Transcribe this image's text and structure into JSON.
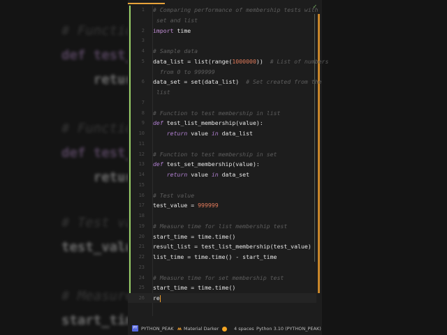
{
  "background_blur": [
    {
      "text": "# Functio",
      "cls": "c"
    },
    {
      "text": "def test_l",
      "cls": "k"
    },
    {
      "text": "    return",
      "cls": ""
    },
    {
      "text": "# Functio",
      "cls": "c"
    },
    {
      "text": "def test_s",
      "cls": "k"
    },
    {
      "text": "    return",
      "cls": ""
    },
    {
      "text": "# Test va",
      "cls": "c"
    },
    {
      "text": "test_value",
      "cls": ""
    },
    {
      "text": "# Measure",
      "cls": "c"
    },
    {
      "text": "start_time",
      "cls": ""
    }
  ],
  "editor": {
    "rows": [
      {
        "ln": "1",
        "html": [
          [
            "cm",
            "# Comparing performance of membership tests with"
          ]
        ]
      },
      {
        "ln": "",
        "html": [
          [
            "cm",
            " set and list"
          ]
        ]
      },
      {
        "ln": "2",
        "html": [
          [
            "kw",
            "import"
          ],
          [
            "",
            " time"
          ]
        ]
      },
      {
        "ln": "3",
        "html": []
      },
      {
        "ln": "4",
        "html": [
          [
            "cm",
            "# Sample data"
          ]
        ]
      },
      {
        "ln": "5",
        "html": [
          [
            "",
            "data_list = list(range("
          ],
          [
            "num",
            "1000000"
          ],
          [
            "",
            "))  "
          ],
          [
            "cm",
            "# List of numbers"
          ]
        ]
      },
      {
        "ln": "",
        "html": [
          [
            "cm",
            "  from 0 to 999999"
          ]
        ]
      },
      {
        "ln": "6",
        "html": [
          [
            "",
            "data_set = set(data_list)  "
          ],
          [
            "cm",
            "# Set created from the"
          ]
        ]
      },
      {
        "ln": "",
        "html": [
          [
            "cm",
            " list"
          ]
        ]
      },
      {
        "ln": "7",
        "html": []
      },
      {
        "ln": "8",
        "html": [
          [
            "cm",
            "# Function to test membership in list"
          ]
        ]
      },
      {
        "ln": "9",
        "html": [
          [
            "kwi",
            "def"
          ],
          [
            "",
            " test_list_membership(value):"
          ]
        ]
      },
      {
        "ln": "10",
        "html": [
          [
            "",
            "    "
          ],
          [
            "kwi",
            "return"
          ],
          [
            "",
            " value "
          ],
          [
            "kwi",
            "in"
          ],
          [
            "",
            " data_list"
          ]
        ]
      },
      {
        "ln": "11",
        "html": []
      },
      {
        "ln": "12",
        "html": [
          [
            "cm",
            "# Function to test membership in set"
          ]
        ]
      },
      {
        "ln": "13",
        "html": [
          [
            "kwi",
            "def"
          ],
          [
            "",
            " test_set_membership(value):"
          ]
        ]
      },
      {
        "ln": "14",
        "html": [
          [
            "",
            "    "
          ],
          [
            "kwi",
            "return"
          ],
          [
            "",
            " value "
          ],
          [
            "kwi",
            "in"
          ],
          [
            "",
            " data_set"
          ]
        ]
      },
      {
        "ln": "15",
        "html": []
      },
      {
        "ln": "16",
        "html": [
          [
            "cm",
            "# Test value"
          ]
        ]
      },
      {
        "ln": "17",
        "html": [
          [
            "",
            "test_value = "
          ],
          [
            "num",
            "999999"
          ]
        ]
      },
      {
        "ln": "18",
        "html": []
      },
      {
        "ln": "19",
        "html": [
          [
            "cm",
            "# Measure time for list membership test"
          ]
        ]
      },
      {
        "ln": "20",
        "html": [
          [
            "",
            "start_time = time.time()"
          ]
        ]
      },
      {
        "ln": "21",
        "html": [
          [
            "",
            "result_list = test_list_membership(test_value)"
          ]
        ]
      },
      {
        "ln": "22",
        "html": [
          [
            "",
            "list_time = time.time() - start_time"
          ]
        ]
      },
      {
        "ln": "23",
        "html": []
      },
      {
        "ln": "24",
        "html": [
          [
            "cm",
            "# Measure time for set membership test"
          ]
        ]
      },
      {
        "ln": "25",
        "html": [
          [
            "",
            "start_time = time.time()"
          ]
        ]
      },
      {
        "ln": "26",
        "html": [
          [
            "",
            "re"
          ]
        ],
        "current": true
      }
    ]
  },
  "status": {
    "project_badge": "PY",
    "project": "PYTHON_PEAK",
    "theme": "Material Darker",
    "indent": "4 spaces",
    "interpreter": "Python 3.10 (PYTHON_PEAK)"
  }
}
